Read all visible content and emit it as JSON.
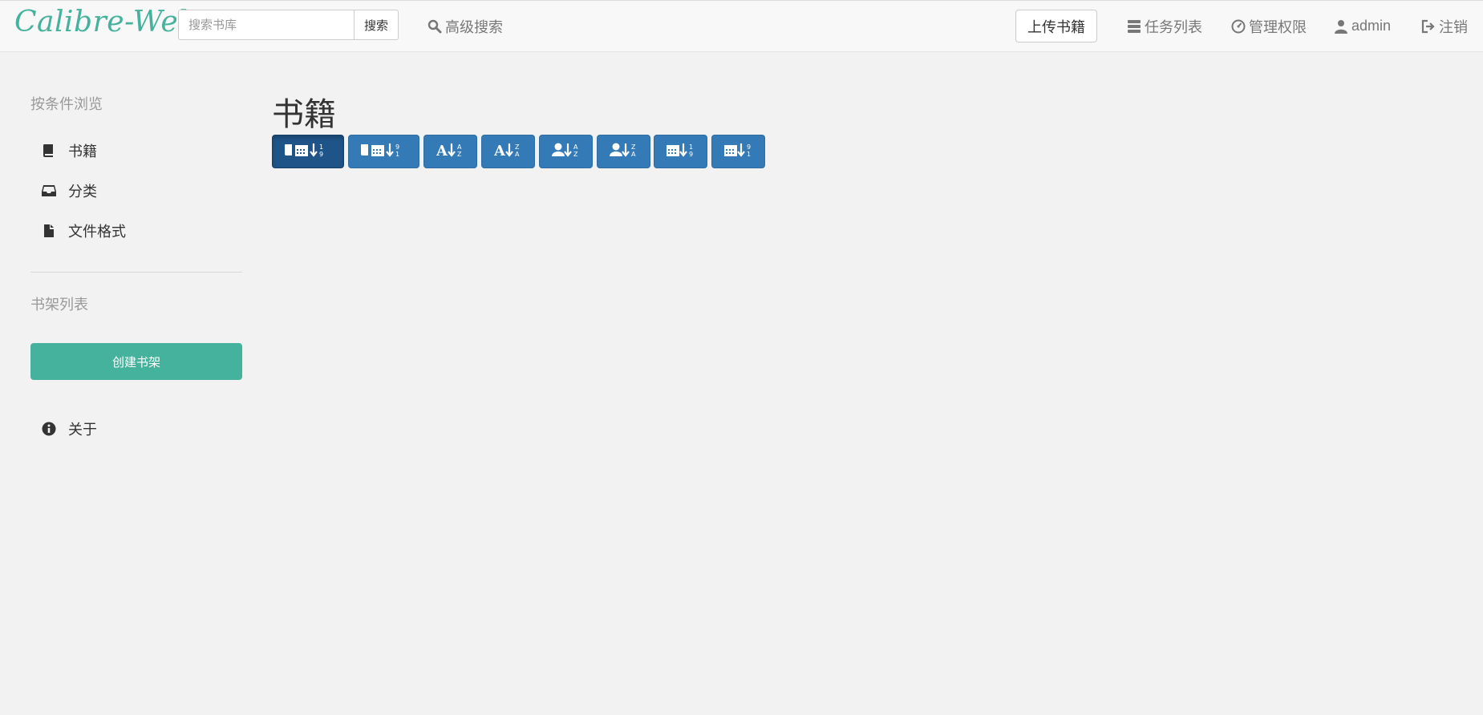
{
  "app": {
    "brand": "Calibre-Web"
  },
  "search": {
    "placeholder": "搜索书库",
    "button_label": "搜索"
  },
  "nav": {
    "advanced_search": "高级搜索",
    "upload": "上传书籍",
    "tasks": "任务列表",
    "admin": "管理权限",
    "user": "admin",
    "logout": "注销"
  },
  "sidebar": {
    "browse_heading": "按条件浏览",
    "items": [
      {
        "label": "书籍",
        "icon": "book-icon"
      },
      {
        "label": "分类",
        "icon": "inbox-icon"
      },
      {
        "label": "文件格式",
        "icon": "file-icon"
      }
    ],
    "shelves_heading": "书架列表",
    "create_shelf": "创建书架",
    "about": "关于"
  },
  "main": {
    "title": "书籍",
    "sort_buttons": [
      {
        "icon": "sort-book-date-asc-icon",
        "active": true
      },
      {
        "icon": "sort-book-date-desc-icon",
        "active": false
      },
      {
        "icon": "sort-title-az-icon",
        "active": false
      },
      {
        "icon": "sort-title-za-icon",
        "active": false
      },
      {
        "icon": "sort-author-az-icon",
        "active": false
      },
      {
        "icon": "sort-author-za-icon",
        "active": false
      },
      {
        "icon": "sort-pubdate-asc-icon",
        "active": false
      },
      {
        "icon": "sort-pubdate-desc-icon",
        "active": false
      }
    ]
  },
  "colors": {
    "brand": "#45b29d",
    "primary": "#337ab7",
    "primary_active": "#1f5488",
    "navbar_bg": "#f8f8f8",
    "page_bg": "#f2f2f2"
  }
}
